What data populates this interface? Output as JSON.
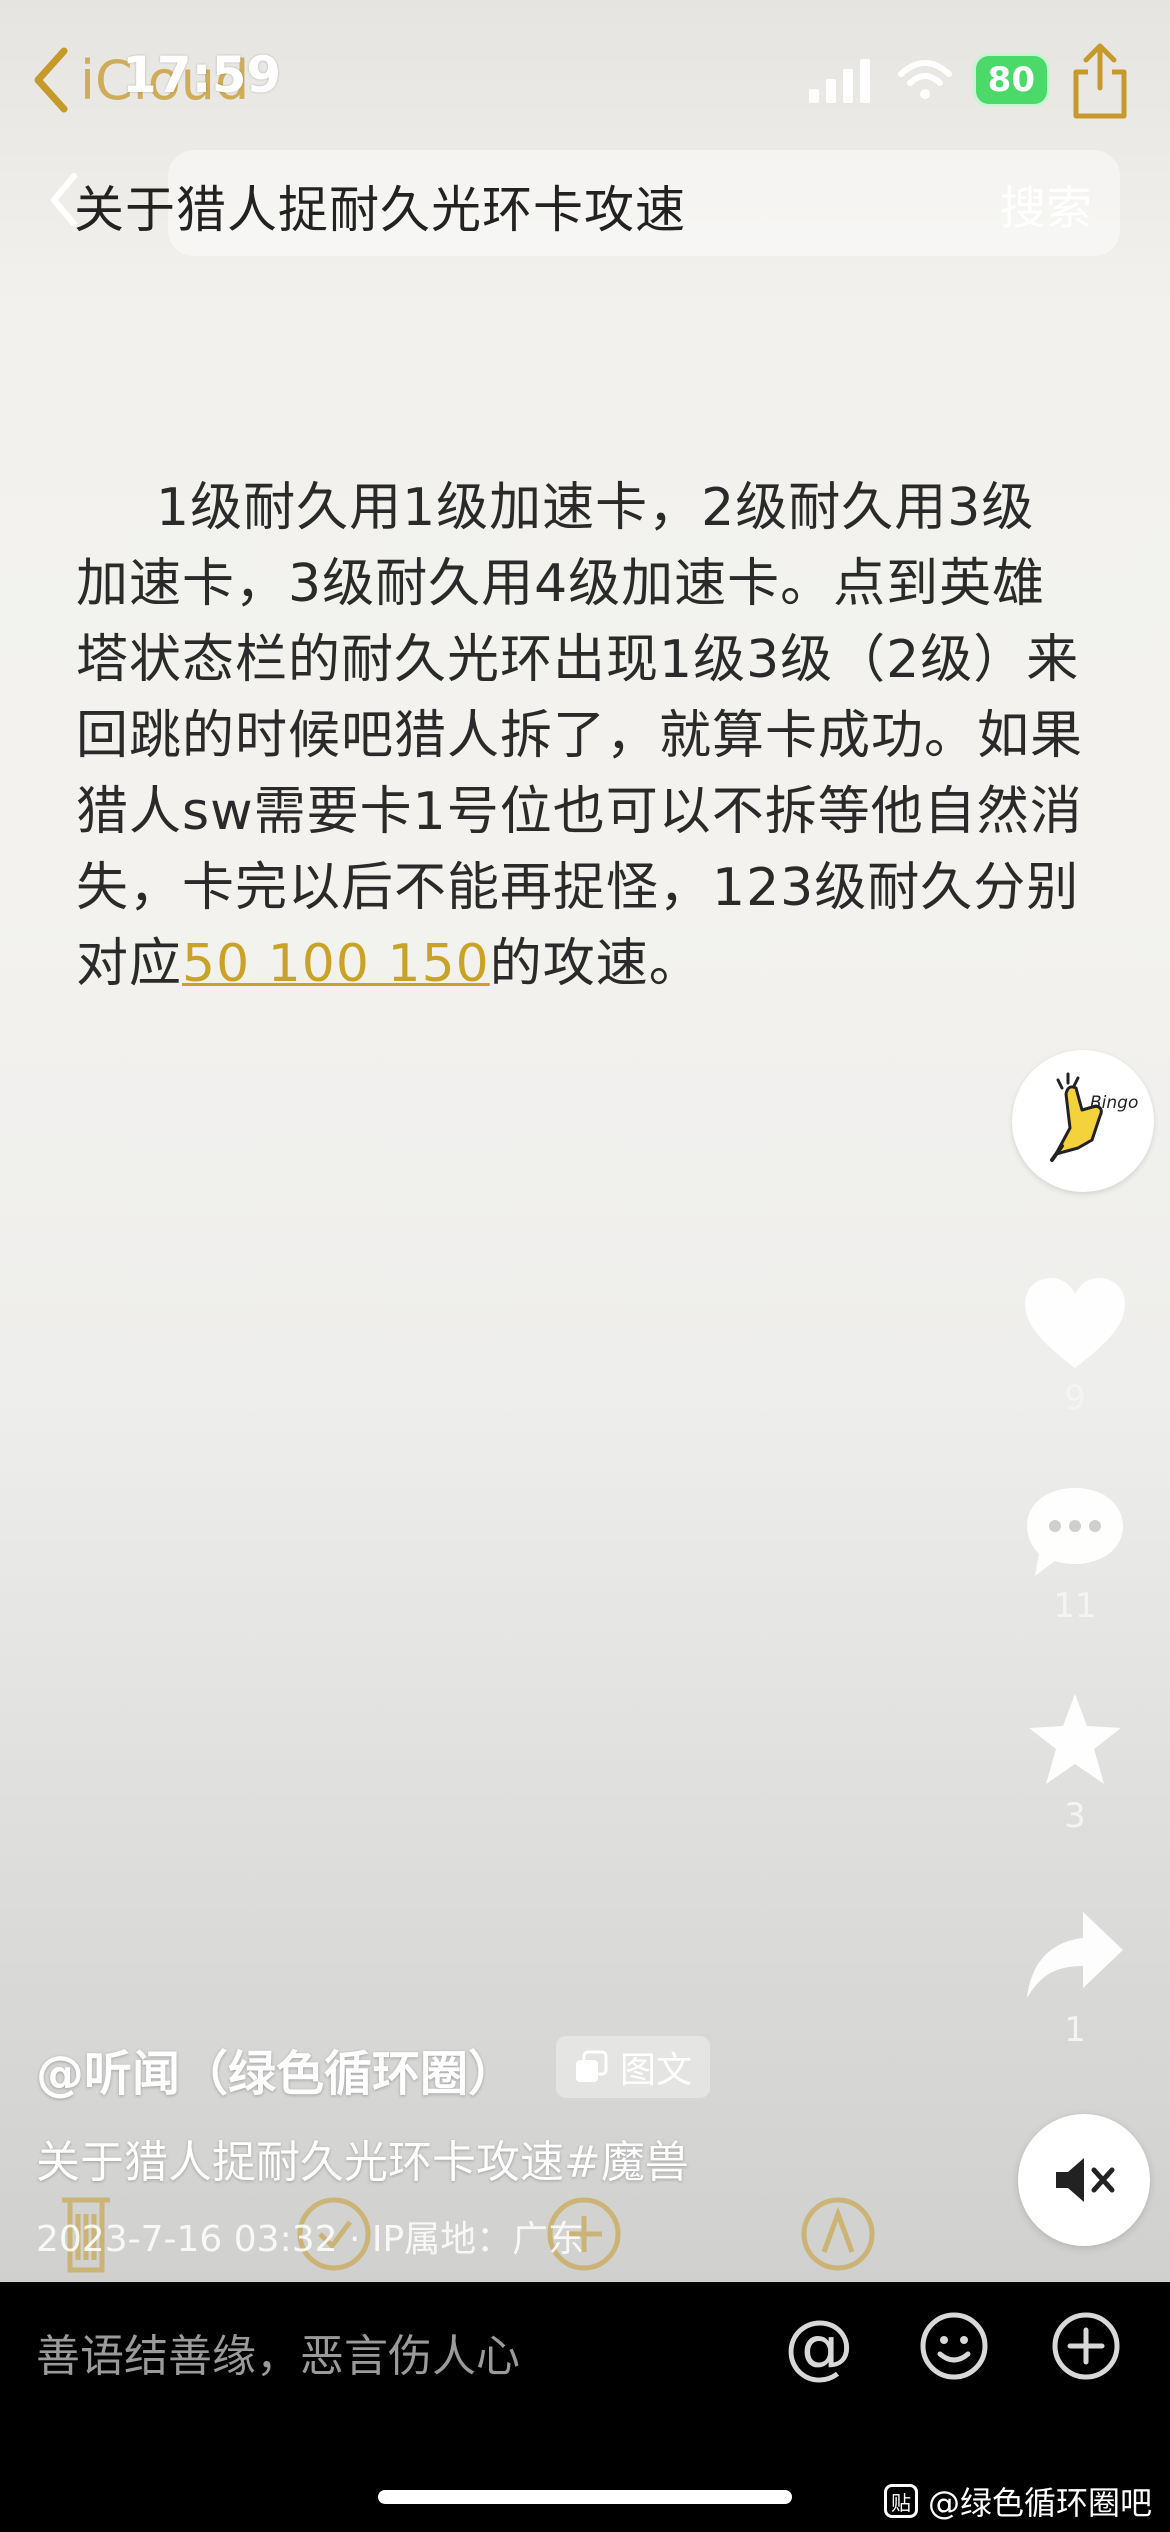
{
  "status_bar": {
    "back_app_label": "iCloud",
    "time": "17:59",
    "battery": "80"
  },
  "header": {
    "query": "关于猎人捉耐久光环卡攻速",
    "search_label": "搜索"
  },
  "note": {
    "body_before_link": "1级耐久用1级加速卡，2级耐久用3级加速卡，3级耐久用4级加速卡。点到英雄塔状态栏的耐久光环出现1级3级（2级）来回跳的时候吧猎人拆了，就算卡成功。如果猎人sw需要卡1号位也可以不拆等他自然消失，卡完以后不能再捉怪，123级耐久分别对应",
    "link_text": "50 100 150",
    "body_after_link": "的攻速。"
  },
  "rail": {
    "like_count": "9",
    "comment_count": "11",
    "favorite_count": "3",
    "share_count": "1"
  },
  "post": {
    "author": "@听闻（绿色循环圈）",
    "type_tag": "图文",
    "caption": "关于猎人捉耐久光环卡攻速#魔兽",
    "meta": "2023-7-16 03:32 · IP属地：广东"
  },
  "comment_bar": {
    "placeholder": "善语结善缘，恶言伤人心",
    "at_icon": "@"
  },
  "watermark": {
    "icon_glyph": "贴",
    "text": "@绿色循环圈吧"
  },
  "colors": {
    "accent_gold": "#c9a227",
    "battery_green": "#4bd96a"
  }
}
